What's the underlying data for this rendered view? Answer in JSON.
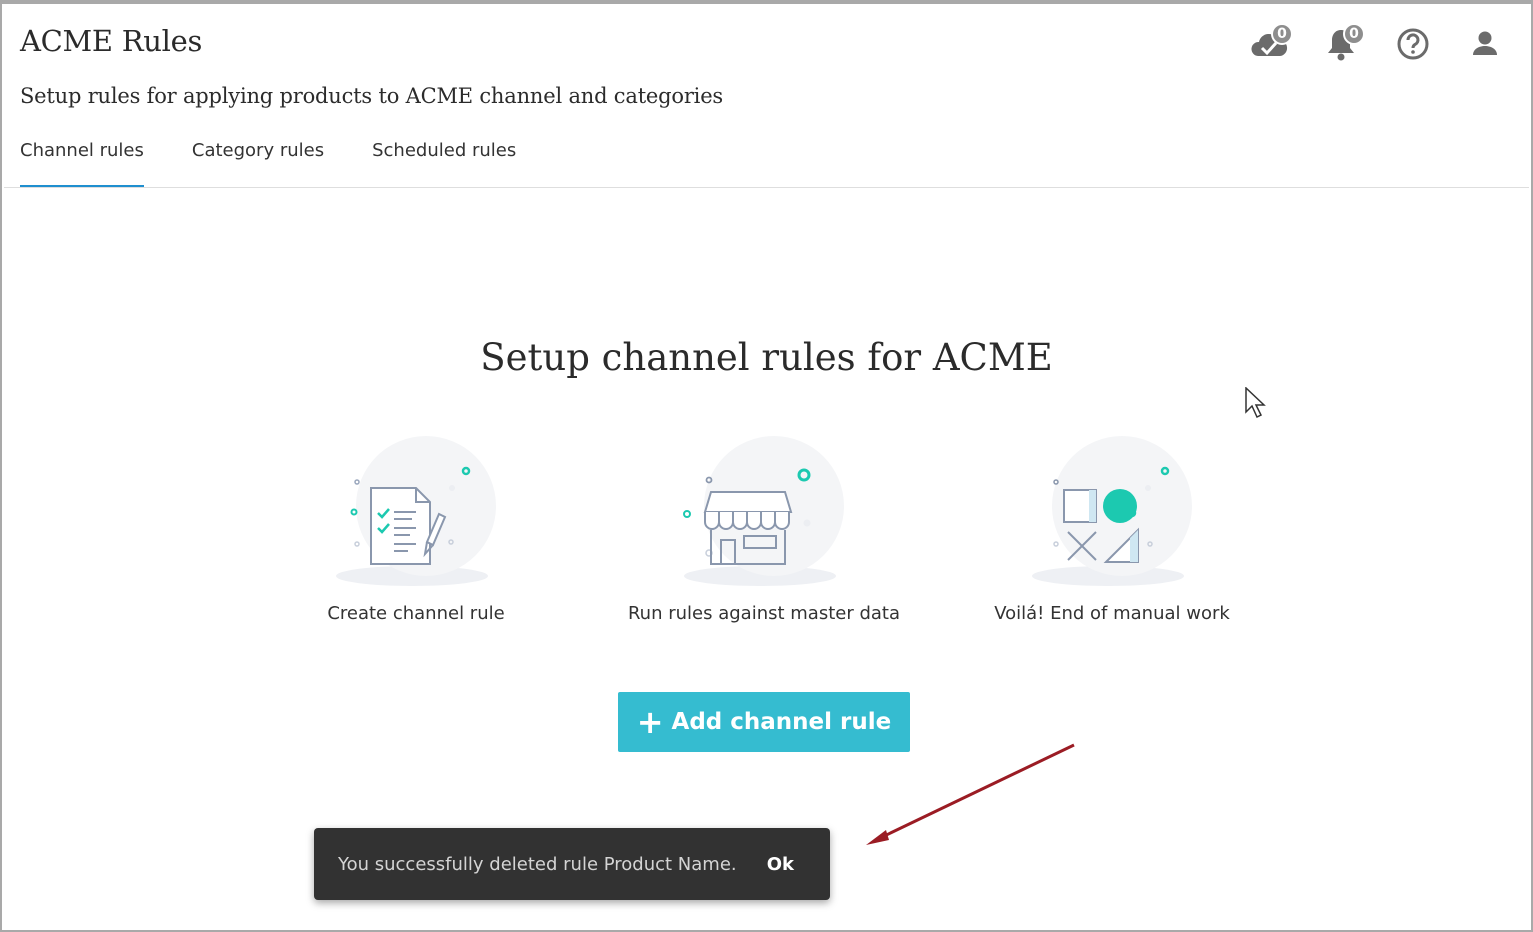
{
  "header": {
    "title": "ACME Rules",
    "subtitle": "Setup rules for applying products to ACME channel and categories",
    "icons": [
      {
        "name": "cloud-check-icon",
        "badge": "0"
      },
      {
        "name": "bell-icon",
        "badge": "0"
      },
      {
        "name": "help-icon"
      },
      {
        "name": "user-icon"
      }
    ]
  },
  "tabs": [
    {
      "label": "Channel rules",
      "active": true
    },
    {
      "label": "Category rules",
      "active": false
    },
    {
      "label": "Scheduled rules",
      "active": false
    }
  ],
  "main": {
    "heading": "Setup channel rules for ACME",
    "steps": [
      {
        "label": "Create channel rule",
        "icon": "checklist-document-icon"
      },
      {
        "label": "Run rules against master data",
        "icon": "storefront-icon"
      },
      {
        "label": "Voilá! End of manual work",
        "icon": "shapes-icon"
      }
    ],
    "add_button_label": "Add channel rule"
  },
  "toast": {
    "message": "You successfully deleted rule Product Name.",
    "action_label": "Ok"
  },
  "colors": {
    "accent_tab": "#1f8fcf",
    "button": "#35bcd0",
    "teal": "#1cc9b0",
    "toast_bg": "#323232",
    "annotation_arrow": "#9b1c24"
  }
}
